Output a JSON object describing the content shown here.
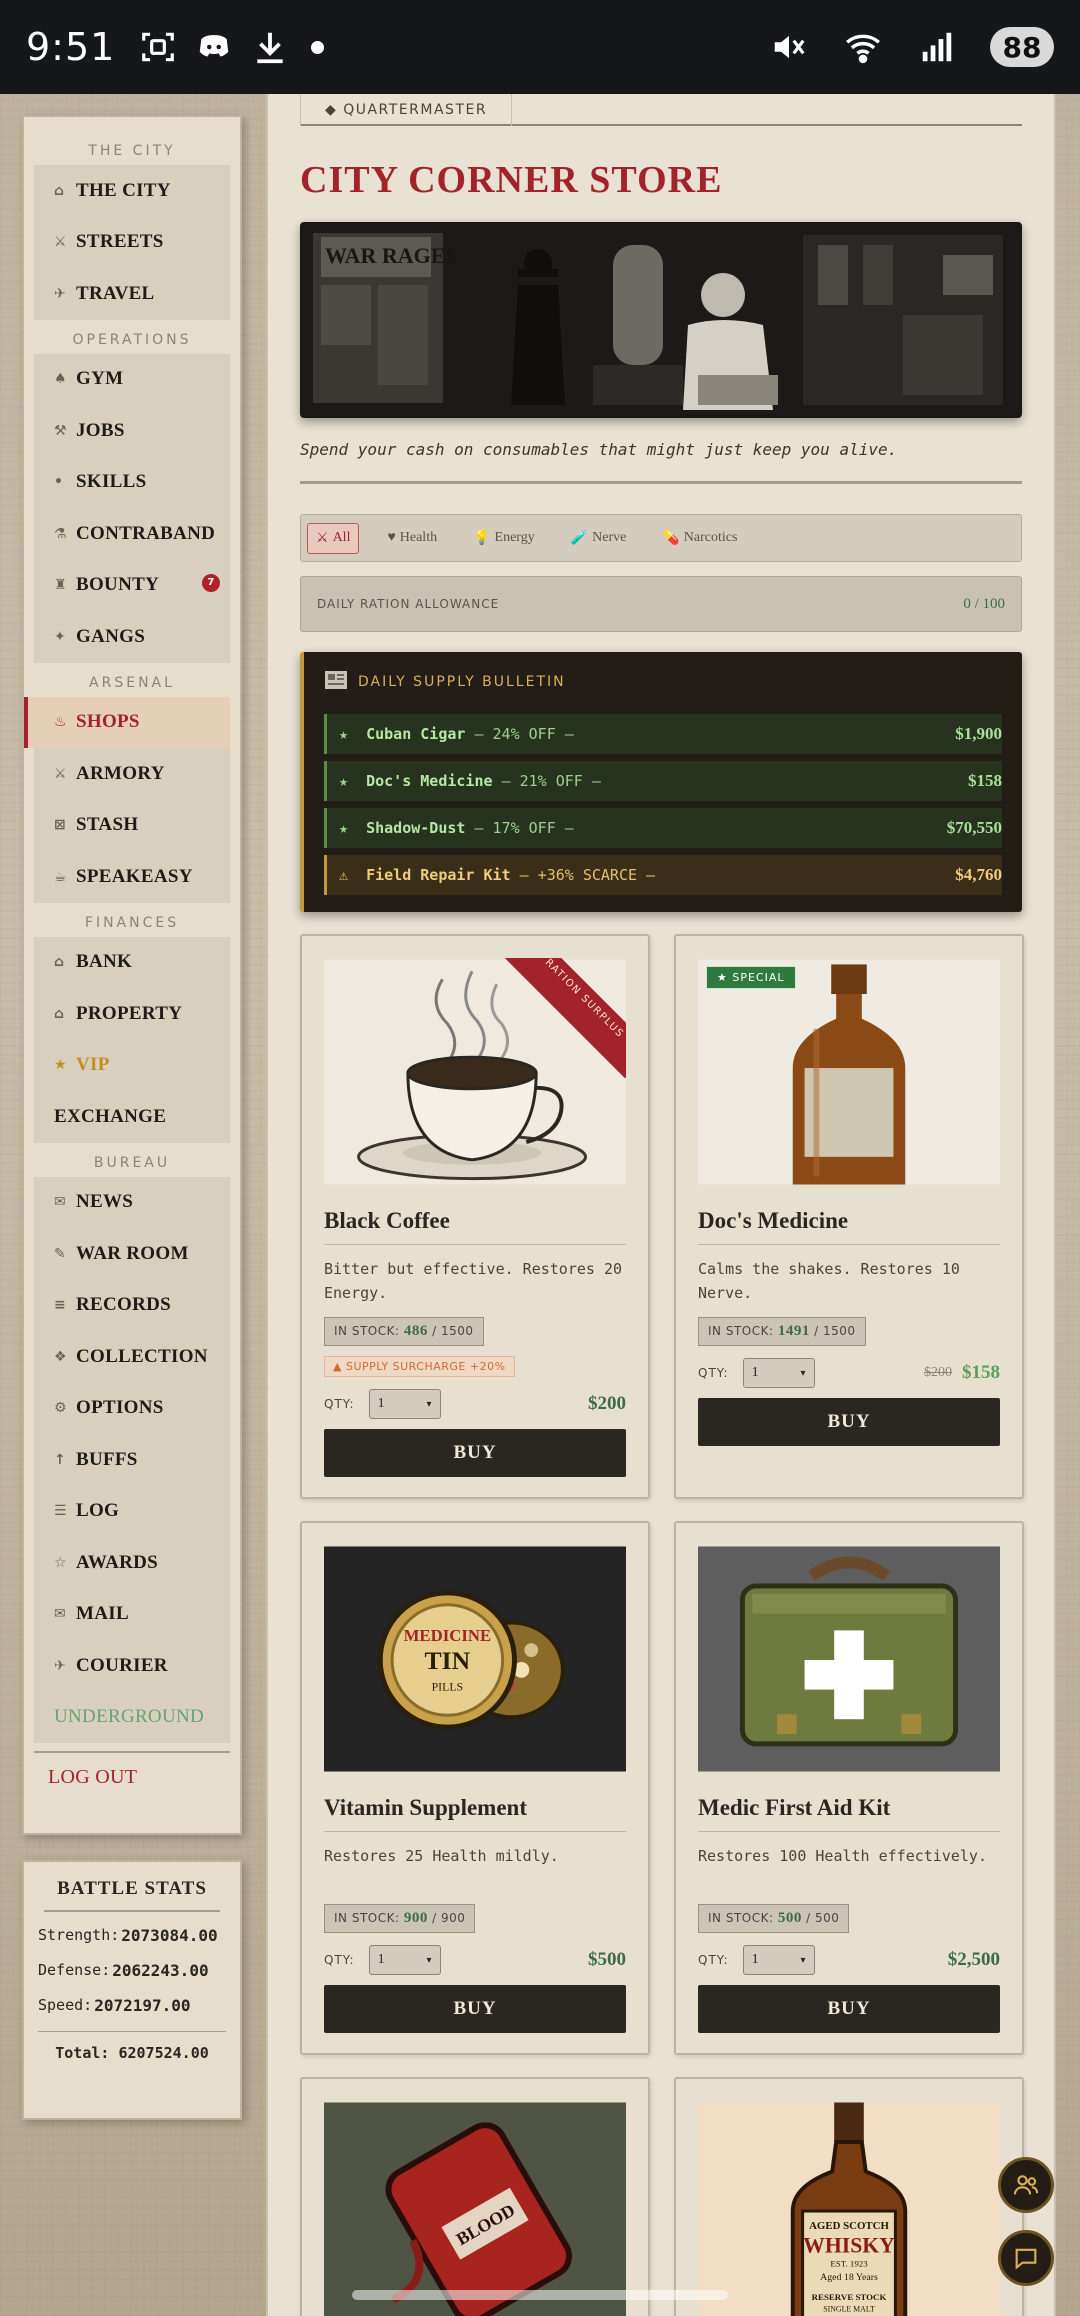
{
  "status_bar": {
    "time": "9:51",
    "battery": "88"
  },
  "sidebar": {
    "sections": [
      {
        "title": "THE CITY",
        "items": [
          {
            "label": "THE CITY",
            "icon": "⌂"
          },
          {
            "label": "STREETS",
            "icon": "⚔"
          },
          {
            "label": "TRAVEL",
            "icon": "✈"
          }
        ]
      },
      {
        "title": "OPERATIONS",
        "items": [
          {
            "label": "GYM",
            "icon": "♠"
          },
          {
            "label": "JOBS",
            "icon": "⚒"
          },
          {
            "label": "SKILLS",
            "icon": "•"
          },
          {
            "label": "CONTRABAND",
            "icon": "⚗"
          },
          {
            "label": "BOUNTY",
            "icon": "♜",
            "badge": "7"
          },
          {
            "label": "GANGS",
            "icon": "✦"
          }
        ]
      },
      {
        "title": "ARSENAL",
        "items": [
          {
            "label": "SHOPS",
            "icon": "♨",
            "active": true
          },
          {
            "label": "ARMORY",
            "icon": "⚔"
          },
          {
            "label": "STASH",
            "icon": "⊠"
          },
          {
            "label": "SPEAKEASY",
            "icon": "☕"
          }
        ]
      },
      {
        "title": "FINANCES",
        "items": [
          {
            "label": "BANK",
            "icon": "⌂"
          },
          {
            "label": "PROPERTY",
            "icon": "⌂"
          },
          {
            "label": "VIP",
            "icon": "★",
            "vip": true
          },
          {
            "label": "EXCHANGE",
            "icon": ""
          }
        ]
      },
      {
        "title": "BUREAU",
        "items": [
          {
            "label": "NEWS",
            "icon": "✉"
          },
          {
            "label": "WAR ROOM",
            "icon": "✎"
          },
          {
            "label": "RECORDS",
            "icon": "≡"
          },
          {
            "label": "COLLECTION",
            "icon": "❖"
          },
          {
            "label": "OPTIONS",
            "icon": "⚙"
          },
          {
            "label": "BUFFS",
            "icon": "↑"
          },
          {
            "label": "LOG",
            "icon": "☰"
          },
          {
            "label": "AWARDS",
            "icon": "☆"
          },
          {
            "label": "MAIL",
            "icon": "✉"
          },
          {
            "label": "COURIER",
            "icon": "✈"
          },
          {
            "label": "UNDERGROUND",
            "icon": "",
            "under": true
          }
        ]
      }
    ],
    "logout": "LOG OUT"
  },
  "battle_stats": {
    "title": "BATTLE STATS",
    "strength_label": "Strength:",
    "strength": "2073084.00",
    "defense_label": "Defense:",
    "defense": "2062243.00",
    "speed_label": "Speed:",
    "speed": "2072197.00",
    "total": "Total: 6207524.00"
  },
  "main": {
    "tab": "◆ QUARTERMASTER",
    "title": "CITY CORNER STORE",
    "hero_sign": "WAR RAGES",
    "tagline": "Spend your cash on consumables that might just keep you alive.",
    "filters": [
      {
        "label": "All",
        "icon": "⚔",
        "active": true
      },
      {
        "label": "Health",
        "icon": "♥"
      },
      {
        "label": "Energy",
        "icon": "💡"
      },
      {
        "label": "Nerve",
        "icon": "🧪"
      },
      {
        "label": "Narcotics",
        "icon": "💊"
      }
    ],
    "ration": {
      "label": "DAILY RATION ALLOWANCE",
      "value": "0 / 100"
    },
    "bulletin": {
      "title": "DAILY SUPPLY BULLETIN",
      "rows": [
        {
          "icon": "★",
          "name": "Cuban Cigar",
          "note": "— 24% OFF —",
          "price": "$1,900"
        },
        {
          "icon": "★",
          "name": "Doc's Medicine",
          "note": "— 21% OFF —",
          "price": "$158"
        },
        {
          "icon": "★",
          "name": "Shadow-Dust",
          "note": "— 17% OFF —",
          "price": "$70,550"
        },
        {
          "icon": "⚠",
          "name": "Field Repair Kit",
          "note": "— +36% SCARCE —",
          "price": "$4,760",
          "scarce": true
        }
      ]
    },
    "products": [
      {
        "name": "Black Coffee",
        "desc": "Bitter but effective. Restores 20 Energy.",
        "stock_label": "IN STOCK:",
        "stock": "486",
        "stock_max": "/ 1500",
        "surcharge": "▲ SUPPLY SURCHARGE +20%",
        "ribbon": "RATION SURPLUS",
        "qty_label": "QTY:",
        "qty": "1",
        "price": "$200",
        "buy": "BUY"
      },
      {
        "name": "Doc's Medicine",
        "desc": "Calms the shakes. Restores 10 Nerve.",
        "stock_label": "IN STOCK:",
        "stock": "1491",
        "stock_max": "/ 1500",
        "special": "★ SPECIAL",
        "qty_label": "QTY:",
        "qty": "1",
        "old_price": "$200",
        "price": "$158",
        "buy": "BUY"
      },
      {
        "name": "Vitamin Supplement",
        "desc": "Restores 25 Health mildly.",
        "stock_label": "IN STOCK:",
        "stock": "900",
        "stock_max": "/ 900",
        "img_text_1": "MEDICINE",
        "img_text_2": "TIN",
        "img_text_3": "PILLS",
        "qty_label": "QTY:",
        "qty": "1",
        "price": "$500",
        "buy": "BUY"
      },
      {
        "name": "Medic First Aid Kit",
        "desc": "Restores 100 Health effectively.",
        "stock_label": "IN STOCK:",
        "stock": "500",
        "stock_max": "/ 500",
        "qty_label": "QTY:",
        "qty": "1",
        "price": "$2,500",
        "buy": "BUY"
      },
      {
        "name": "",
        "img_text_1": "BLOOD"
      },
      {
        "name": "",
        "img_text_1": "AGED SCOTCH",
        "img_text_2": "WHISKY",
        "img_text_3": "EST. 1923",
        "img_text_4": "Aged 18 Years",
        "img_text_5": "RESERVE STOCK",
        "img_text_6": "SINGLE MALT"
      }
    ]
  }
}
